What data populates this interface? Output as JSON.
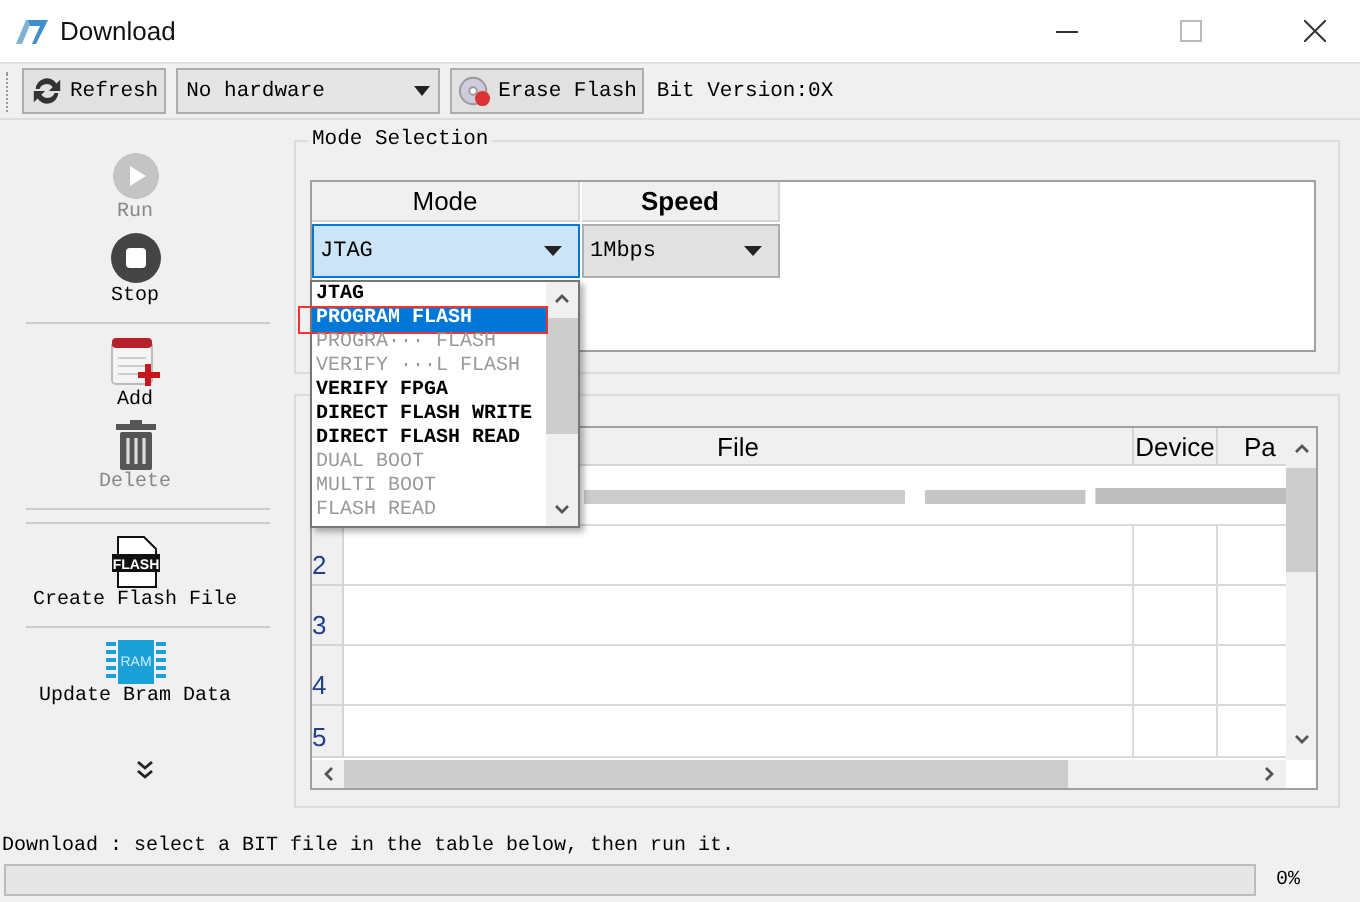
{
  "window": {
    "title": "Download"
  },
  "toolbar": {
    "refresh": "Refresh",
    "hardware": "No hardware",
    "erase": "Erase Flash",
    "bit_version": "Bit Version:0X"
  },
  "sidebar": {
    "items": [
      {
        "kind": "run",
        "label": "Run",
        "disabled": true
      },
      {
        "kind": "stop",
        "label": "Stop",
        "disabled": false
      },
      {
        "kind": "add",
        "label": "Add",
        "disabled": false
      },
      {
        "kind": "delete",
        "label": "Delete",
        "disabled": true
      },
      {
        "kind": "flash",
        "label": "Create Flash File",
        "disabled": false,
        "badge": "FLASH"
      },
      {
        "kind": "bram",
        "label": "Update Bram Data",
        "disabled": false,
        "badge": "RAM"
      }
    ]
  },
  "mode_selection": {
    "title": "Mode Selection",
    "columns": [
      "Mode",
      "Speed"
    ],
    "mode": "JTAG",
    "speed": "1Mbps",
    "mode_list": [
      {
        "label": "JTAG",
        "disabled": false,
        "selected": false,
        "highlighted": false
      },
      {
        "label": "PROGRAM FLASH",
        "disabled": false,
        "selected": true,
        "highlighted": true
      },
      {
        "label": "PROGRA··· FLASH",
        "disabled": true,
        "selected": false,
        "highlighted": false
      },
      {
        "label": "VERIFY ···L FLASH",
        "disabled": true,
        "selected": false,
        "highlighted": false
      },
      {
        "label": "VERIFY FPGA",
        "disabled": false,
        "selected": false,
        "highlighted": false
      },
      {
        "label": "DIRECT FLASH WRITE",
        "disabled": false,
        "selected": false,
        "highlighted": false
      },
      {
        "label": "DIRECT FLASH READ",
        "disabled": false,
        "selected": false,
        "highlighted": false
      },
      {
        "label": "DUAL BOOT",
        "disabled": true,
        "selected": false,
        "highlighted": false
      },
      {
        "label": "MULTI BOOT",
        "disabled": true,
        "selected": false,
        "highlighted": false
      },
      {
        "label": "FLASH READ",
        "disabled": true,
        "selected": false,
        "highlighted": false
      }
    ]
  },
  "files": {
    "columns": [
      "File",
      "Device",
      "Pa"
    ],
    "rows": [
      {
        "kind": "blurred"
      },
      {
        "kind": "plain",
        "number": "2"
      },
      {
        "kind": "plain",
        "number": "3"
      },
      {
        "kind": "plain",
        "number": "4"
      },
      {
        "kind": "plain",
        "number": "5"
      }
    ]
  },
  "status": {
    "message": "Download : select a BIT file in the table below, then run it.",
    "progress": {
      "level": 0,
      "reading": "0%"
    }
  }
}
